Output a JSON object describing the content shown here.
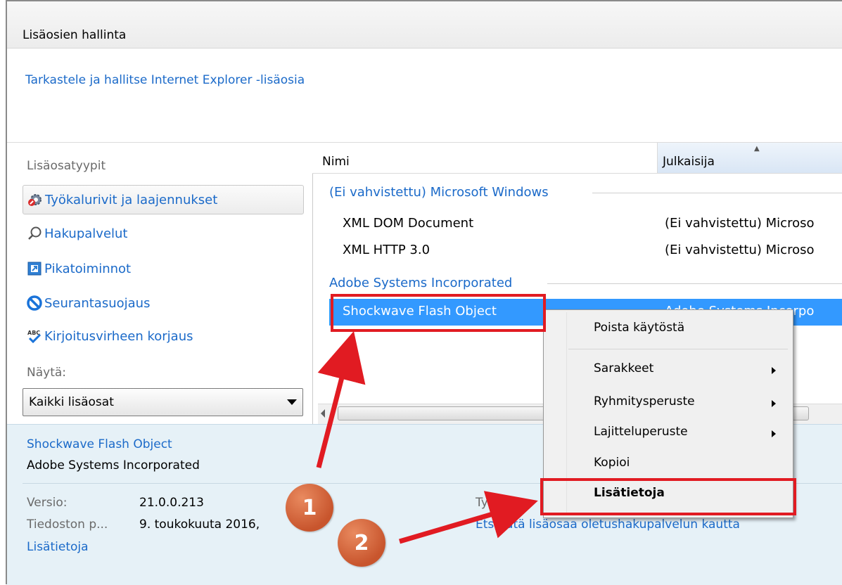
{
  "window": {
    "title": "Lisäosien hallinta",
    "subtitle": "Tarkastele ja hallitse Internet Explorer -lisäosia"
  },
  "sidebar": {
    "heading": "Lisäosatyypit",
    "items": [
      {
        "label": "Työkalurivit ja laajennukset",
        "icon": "gear-icon",
        "selected": true
      },
      {
        "label": "Hakupalvelut",
        "icon": "search-icon",
        "selected": false
      },
      {
        "label": "Pikatoiminnot",
        "icon": "accelerator-icon",
        "selected": false
      },
      {
        "label": "Seurantasuojaus",
        "icon": "tracking-protection-icon",
        "selected": false
      },
      {
        "label": "Kirjoitusvirheen korjaus",
        "icon": "spelling-icon",
        "selected": false
      }
    ],
    "show_label": "Näytä:",
    "show_value": "Kaikki lisäosat"
  },
  "list": {
    "columns": [
      "Nimi",
      "Julkaisija"
    ],
    "groups": [
      {
        "name": "(Ei vahvistettu) Microsoft Windows",
        "rows": [
          {
            "name": "XML DOM Document",
            "publisher": "(Ei vahvistettu) Microso"
          },
          {
            "name": "XML HTTP 3.0",
            "publisher": "(Ei vahvistettu) Microso"
          }
        ]
      },
      {
        "name": "Adobe Systems Incorporated",
        "rows": [
          {
            "name": "Shockwave Flash Object",
            "publisher": "Adobe Systems Incorpo",
            "selected": true
          }
        ]
      }
    ]
  },
  "context_menu": {
    "items": [
      {
        "label": "Poista käytöstä",
        "submenu": false
      },
      {
        "label": "Sarakkeet",
        "submenu": true
      },
      {
        "label": "Ryhmitysperuste",
        "submenu": true
      },
      {
        "label": "Lajitteluperuste",
        "submenu": true
      },
      {
        "label": "Kopioi",
        "submenu": false
      },
      {
        "label": "Lisätietoja",
        "submenu": false,
        "bold": true
      }
    ]
  },
  "details": {
    "name": "Shockwave Flash Object",
    "publisher": "Adobe Systems Incorporated",
    "version_label": "Versio:",
    "version_value": "21.0.0.213",
    "filedate_label": "Tiedoston p...",
    "filedate_value": "9. toukokuuta 2016,",
    "type_label": "Tyyppi:",
    "more_link": "Lisätietoja",
    "search_link": "Etsi tätä lisäosaa oletushakupalvelun kautta"
  },
  "annotations": {
    "badge1": "1",
    "badge2": "2",
    "color": "#e11b22"
  }
}
